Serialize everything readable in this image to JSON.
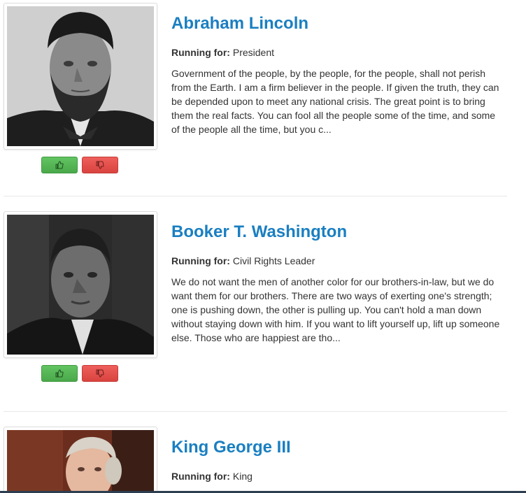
{
  "candidates": [
    {
      "name": "Abraham Lincoln",
      "running_label": "Running for:",
      "running_for": "President",
      "quote": "Government of the people, by the people, for the people, shall not perish from the Earth. I am a firm believer in the people. If given the truth, they can be depended upon to meet any national crisis. The great point is to bring them the real facts. You can fool all the people some of the time, and some of the people all the time, but you c..."
    },
    {
      "name": "Booker T. Washington",
      "running_label": "Running for:",
      "running_for": "Civil Rights Leader",
      "quote": "We do not want the men of another color for our brothers-in-law, but we do want them for our brothers. There are two ways of exerting one's strength; one is pushing down, the other is pulling up. You can't hold a man down without staying down with him. If you want to lift yourself up, lift up someone else. Those who are happiest are tho..."
    },
    {
      "name": "King George III",
      "running_label": "Running for:",
      "running_for": "King",
      "quote": ""
    }
  ],
  "icons": {
    "vote_up": "thumbs-up-icon",
    "vote_down": "thumbs-down-icon"
  },
  "colors": {
    "name_link": "#1a7fc1",
    "vote_up": "#5bb75b",
    "vote_down": "#da4f49"
  }
}
